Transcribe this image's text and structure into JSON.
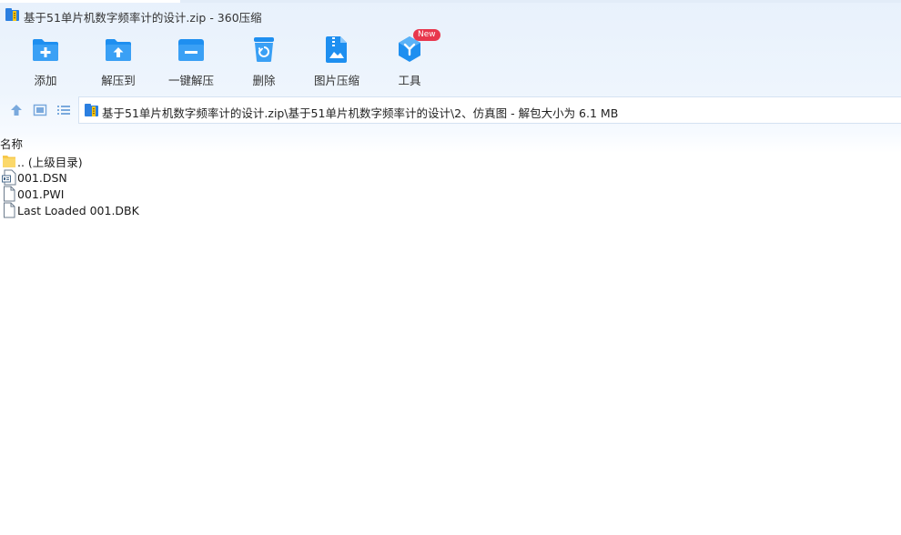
{
  "window": {
    "title": "基于51单片机数字频率计的设计.zip - 360压缩"
  },
  "toolbar": {
    "items": [
      {
        "label": "添加",
        "icon": "add-folder-icon"
      },
      {
        "label": "解压到",
        "icon": "extract-to-icon"
      },
      {
        "label": "一键解压",
        "icon": "one-click-extract-icon"
      },
      {
        "label": "删除",
        "icon": "delete-icon"
      },
      {
        "label": "图片压缩",
        "icon": "image-compress-icon"
      },
      {
        "label": "工具",
        "icon": "tools-icon"
      }
    ],
    "tools_badge": "New"
  },
  "address": {
    "path": "基于51单片机数字频率计的设计.zip\\基于51单片机数字频率计的设计\\2、仿真图 - 解包大小为 6.1 MB"
  },
  "list": {
    "column_name": "名称",
    "rows": [
      {
        "name": ".. (上级目录)",
        "icon": "folder-icon"
      },
      {
        "name": "001.DSN",
        "icon": "dsn-file-icon"
      },
      {
        "name": "001.PWI",
        "icon": "file-icon"
      },
      {
        "name": "Last Loaded 001.DBK",
        "icon": "file-icon"
      }
    ]
  },
  "colors": {
    "accent": "#1e8ff0",
    "chrome_bg": "#e8f1fc",
    "badge": "#e8374d"
  }
}
